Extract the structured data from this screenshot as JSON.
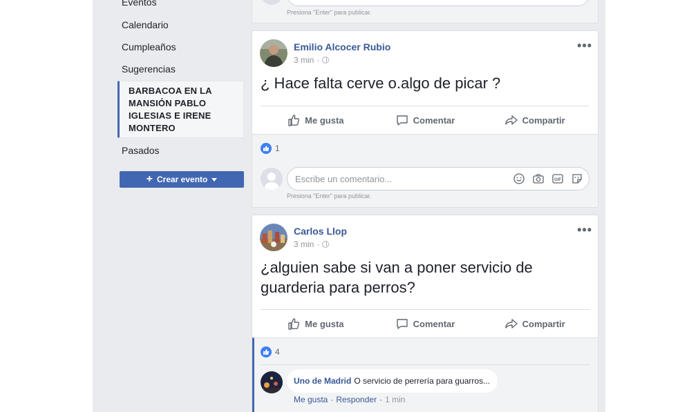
{
  "sidebar": {
    "items": [
      {
        "label": "Eventos"
      },
      {
        "label": "Calendario"
      },
      {
        "label": "Cumpleaños"
      },
      {
        "label": "Sugerencias"
      }
    ],
    "active_event": {
      "lines": [
        "BARBACOA EN LA",
        "MANSIÓN PABLO",
        "IGLESIAS E IRENE",
        "MONTERO"
      ]
    },
    "past_label": "Pasados",
    "create_button": {
      "label": "Crear evento"
    }
  },
  "feed": {
    "enter_hint": "Presiona \"Enter\" para publicar.",
    "actions": {
      "like": "Me gusta",
      "comment": "Comentar",
      "share": "Compartir"
    },
    "comment_placeholder": "Escribe un comentario...",
    "posts": [
      {
        "author": "Emilio Alcocer Rubio",
        "time": "3 min",
        "text": "¿ Hace falta cerve o.algo de picar ?",
        "reactions_count": "1"
      },
      {
        "author": "Carlos Llop",
        "time": "3 min",
        "text": "¿alguien sabe si van a poner servicio de guarderia para perros?",
        "reactions_count": "4",
        "comment": {
          "author": "Uno de Madrid",
          "text": "O servicio de perrería para guarros...",
          "like": "Me gusta",
          "reply": "Responder",
          "time": "1 min"
        }
      }
    ]
  },
  "colors": {
    "accent": "#4267b2",
    "link": "#385898",
    "background": "#e9ebee"
  }
}
